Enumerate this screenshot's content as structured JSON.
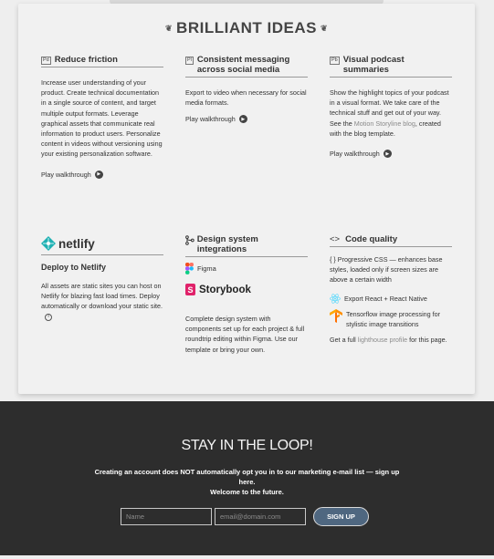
{
  "header": {
    "title": "BRILLIANT IDEAS"
  },
  "ideas": [
    {
      "badge": "Pd",
      "title": "Reduce friction",
      "body": "Increase user understanding of your product. Create technical documentation in a single source of content, and target multiple output formats. Leverage graphical assets that communicate real information to product users. Personalize content in videos without versioning using your existing personalization software.",
      "play": "Play walkthrough"
    },
    {
      "badge": "Pl",
      "title": "Consistent messaging across social media",
      "body": "Export to video when necessary for social media formats.",
      "play": "Play walkthrough"
    },
    {
      "badge": "Pb",
      "title": "Visual podcast summaries",
      "body_before": "Show the highlight topics of your podcast in a visual format. We take care of the technical stuff and get out of your way. See the ",
      "body_link": "Motion Storyline blog",
      "body_after": ", created with the blog template.",
      "play": "Play walkthrough"
    }
  ],
  "netlify": {
    "logo_text": "netlify",
    "subtitle": "Deploy to Netlify",
    "body": "All assets are static sites you can host on Netlify for blazing fast load times. Deploy automatically or download your static site."
  },
  "design": {
    "title": "Design system integrations",
    "figma": "Figma",
    "storybook": "Storybook",
    "body": "Complete design system with components set up for each project & full roundtrip editing within Figma. Use our template or bring your own."
  },
  "code": {
    "title": "Code quality",
    "css_text": "{ } Progressive CSS — enhances base styles, loaded only if screen sizes are above a certain width",
    "react_text": "Export React + React Native",
    "tf_text": "Tensorflow image processing for stylistic image transitions",
    "lh_before": "Get a full ",
    "lh_link": "lighthouse profile",
    "lh_after": " for this page."
  },
  "footer": {
    "title": "STAY IN THE LOOP!",
    "note_line1": "Creating an account does NOT automatically opt you in to our marketing e-mail list — sign up here.",
    "note_line2": "Welcome to the future.",
    "name_placeholder": "Name",
    "email_placeholder": "email@domain.com",
    "signup": "SIGN UP"
  },
  "colors": {
    "footer_bg": "#2d2d2d",
    "button": "#4f6780",
    "netlify_teal": "#1fb1b3",
    "storybook_pink": "#e0226a"
  }
}
